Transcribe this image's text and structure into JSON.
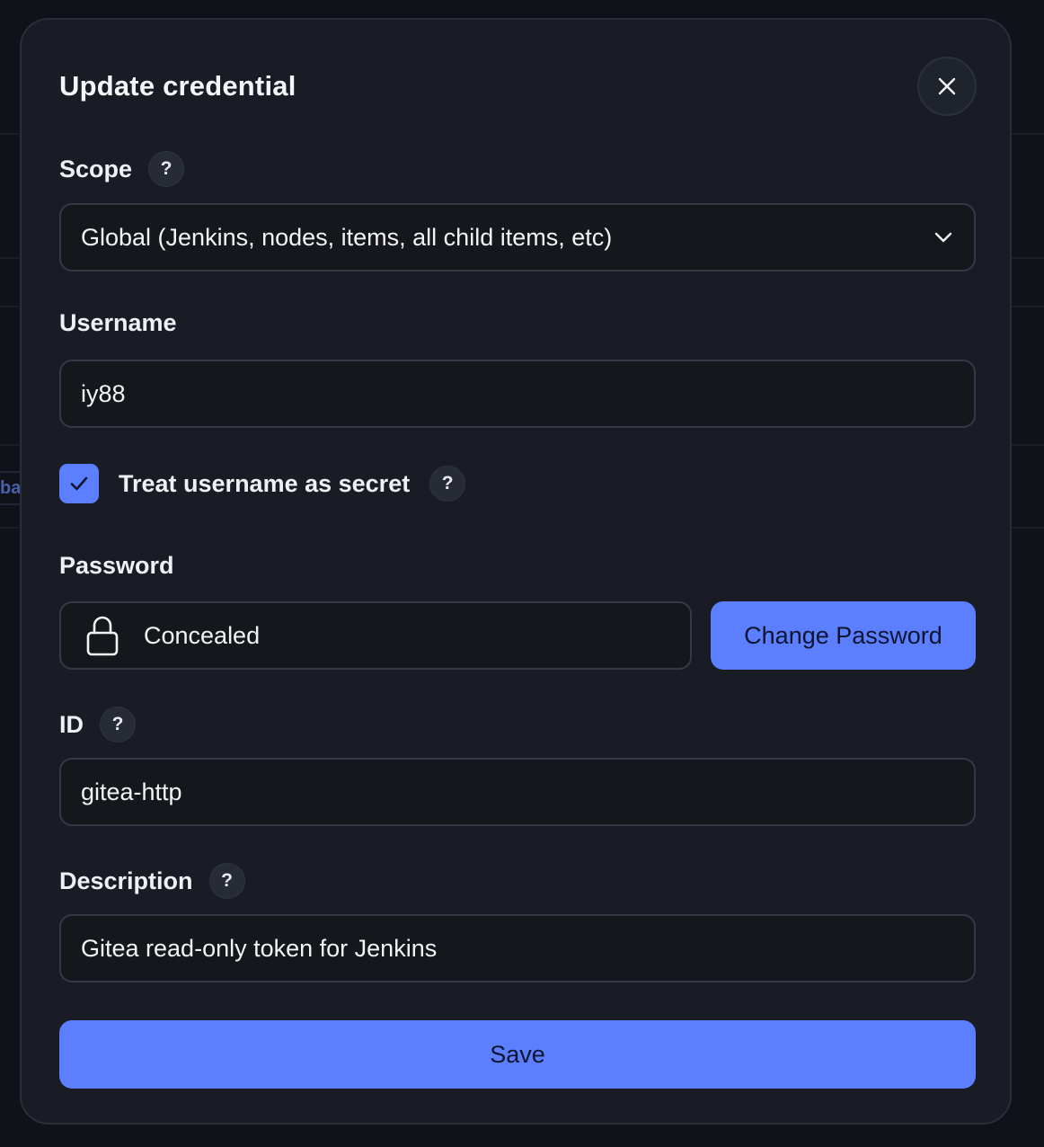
{
  "background": {
    "fragment_text": "ba"
  },
  "dialog": {
    "title": "Update credential",
    "close_icon": "close-icon"
  },
  "scope": {
    "label": "Scope",
    "help": "?",
    "value": "Global (Jenkins, nodes, items, all child items, etc)"
  },
  "username": {
    "label": "Username",
    "value": "iy88"
  },
  "treat_secret": {
    "label": "Treat username as secret",
    "checked": true,
    "help": "?"
  },
  "password": {
    "label": "Password",
    "value": "Concealed",
    "icon": "lock-icon",
    "change_label": "Change Password"
  },
  "id": {
    "label": "ID",
    "help": "?",
    "value": "gitea-http"
  },
  "description": {
    "label": "Description",
    "help": "?",
    "value": "Gitea read-only token for Jenkins"
  },
  "save_label": "Save",
  "colors": {
    "accent": "#5b7fff",
    "dialog_bg": "#191c24",
    "field_bg": "#15171d"
  }
}
